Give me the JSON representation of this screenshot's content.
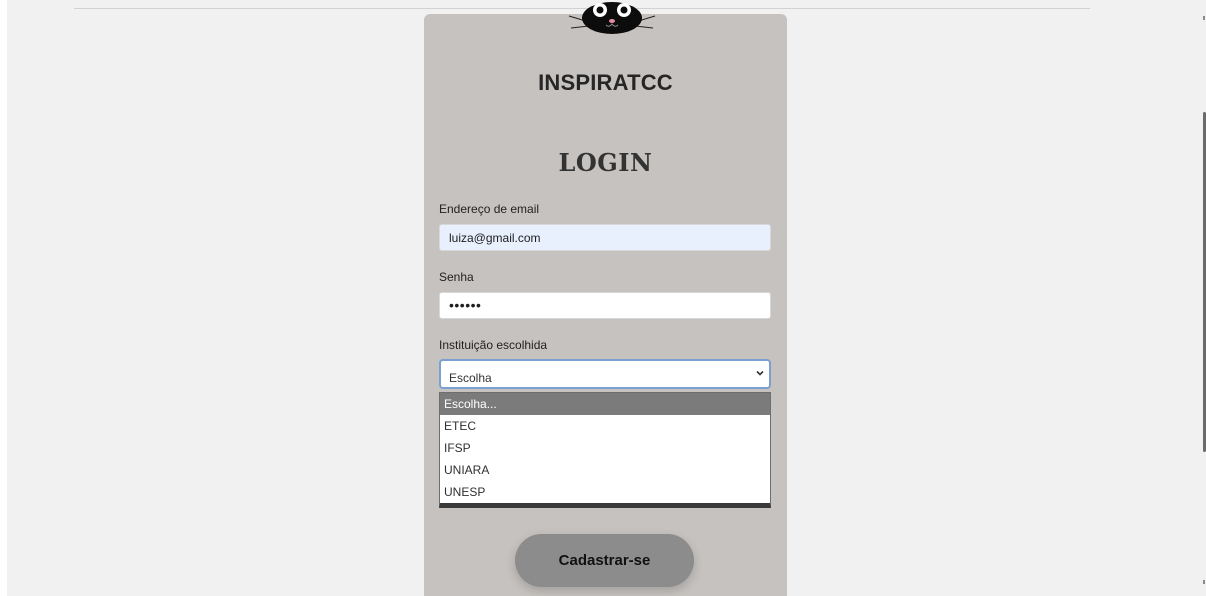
{
  "brand": "INSPIRATCC",
  "login": {
    "title": "LOGIN"
  },
  "email": {
    "label": "Endereço de email",
    "value": "luiza@gmail.com"
  },
  "password": {
    "label": "Senha",
    "value": "••••••"
  },
  "institution": {
    "label": "Instituição escolhida",
    "selected": "Escolha",
    "options": [
      "Escolha...",
      "ETEC",
      "IFSP",
      "UNIARA",
      "UNESP"
    ]
  },
  "register_button": "Cadastrar-se",
  "icons": {
    "logo": "cat-face-icon",
    "select_chevron": "chevron-down-icon"
  },
  "colors": {
    "card": "#c6c2bf",
    "background": "#f1f1f1",
    "email_field": "#e8f0fe",
    "selected_option": "#7b7b7b",
    "button": "#8c8c8c"
  }
}
